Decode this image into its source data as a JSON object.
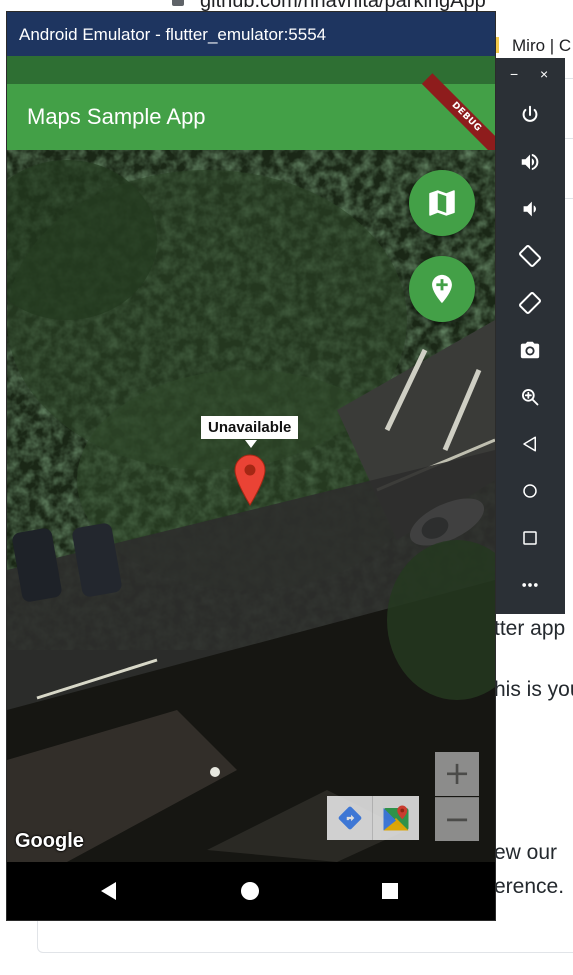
{
  "browser": {
    "url": "github.com/nnavnita/parkingApp",
    "bookmark": "Miro | C",
    "background_text": [
      "tter app",
      "his is you",
      "ew our",
      "erence."
    ]
  },
  "emulator": {
    "window_title": "Android Emulator - flutter_emulator:5554",
    "debug_banner": "DEBUG"
  },
  "app": {
    "title": "Maps Sample App",
    "primary_color": "#43a047",
    "status_bar_color": "#2e6f33"
  },
  "map": {
    "type": "satellite",
    "marker_info_title": "Unavailable",
    "logo_text": "Google",
    "zoom_in_label": "+",
    "zoom_out_label": "−",
    "fabs": [
      {
        "name": "map-type",
        "icon": "map-icon"
      },
      {
        "name": "add-marker",
        "icon": "add-location-icon"
      }
    ]
  },
  "side_panel": {
    "minimize_label": "−",
    "close_label": "×",
    "buttons": [
      "power-icon",
      "volume-up-icon",
      "volume-down-icon",
      "rotate-left-icon",
      "rotate-right-icon",
      "camera-icon",
      "zoom-icon",
      "back-icon",
      "home-icon",
      "overview-icon",
      "more-icon"
    ]
  },
  "nav_bar": {
    "buttons": [
      "back",
      "home",
      "recents"
    ]
  }
}
